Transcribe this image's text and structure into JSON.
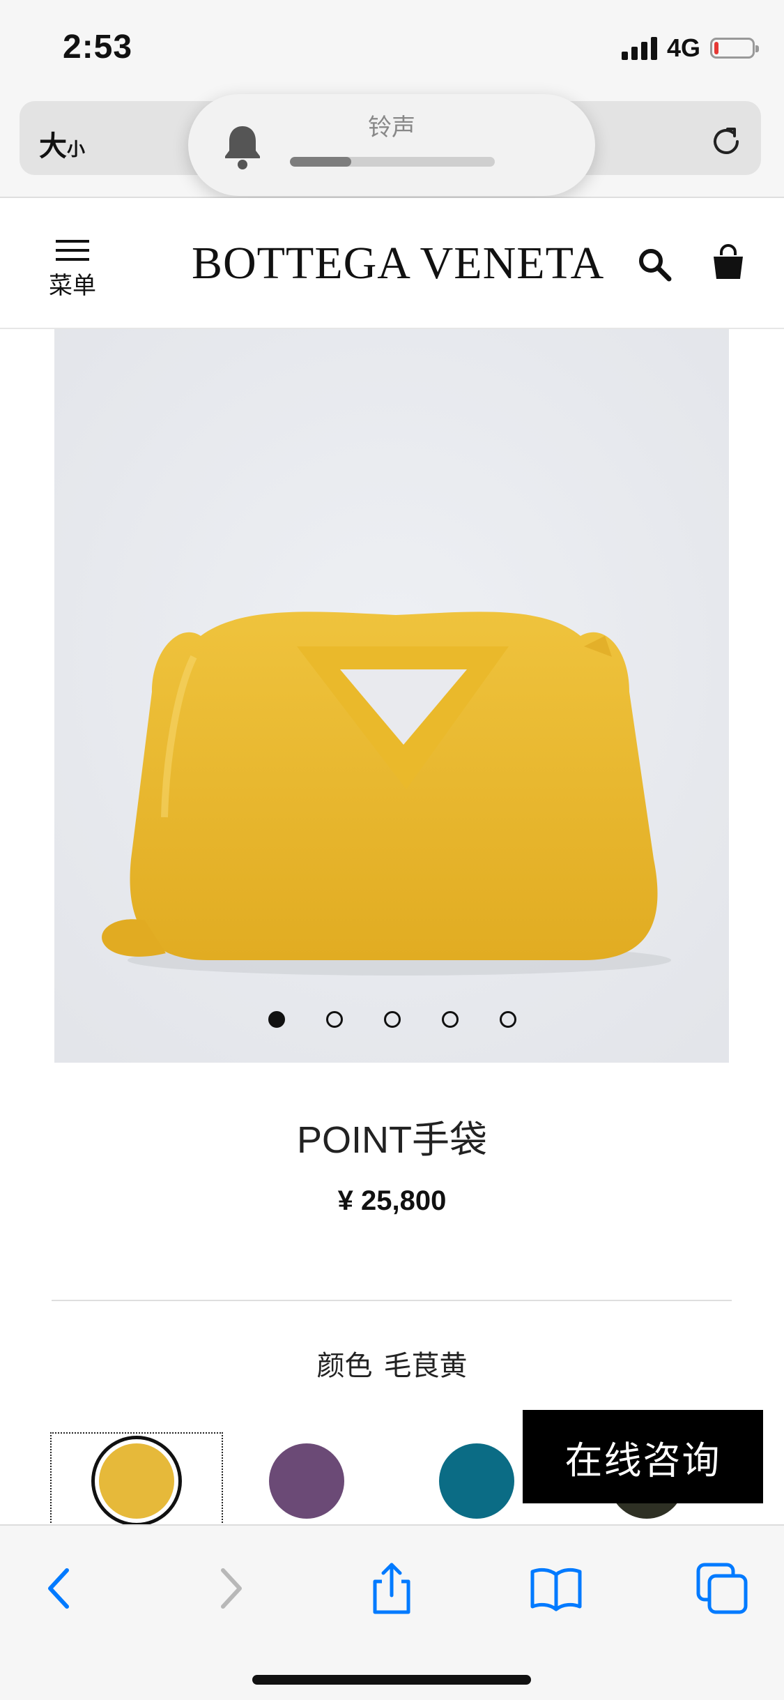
{
  "status_bar": {
    "time": "2:53",
    "network": "4G",
    "battery_level": 0.12
  },
  "browser": {
    "text_size_label_big": "大",
    "text_size_label_small": "小",
    "volume_hud": {
      "label": "铃声",
      "level": 0.3
    }
  },
  "site_header": {
    "menu_label": "菜单",
    "brand": "BOTTEGA VENETA"
  },
  "product": {
    "name": "POINT手袋",
    "price": "¥ 25,800",
    "image_count": 5,
    "active_image_index": 0,
    "color_label": "颜色",
    "color_name": "毛茛黄",
    "swatches": [
      {
        "name": "yellow",
        "color": "#e6b93a",
        "selected": true
      },
      {
        "name": "purple",
        "color": "#6b4a76",
        "selected": false
      },
      {
        "name": "teal",
        "color": "#0b6c85",
        "selected": false
      },
      {
        "name": "dark-olive",
        "color": "#2e3024",
        "selected": false
      }
    ]
  },
  "chat_button": {
    "label": "在线咨询"
  },
  "colors": {
    "accent": "#007aff",
    "bag": "#e8b731"
  }
}
